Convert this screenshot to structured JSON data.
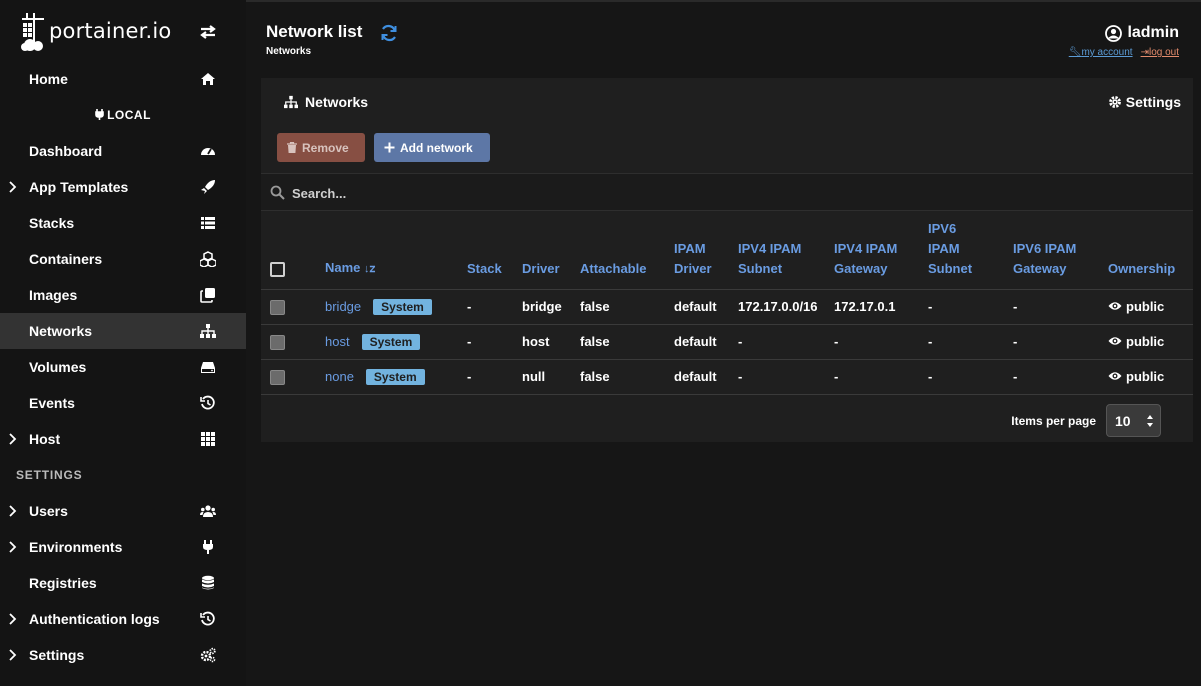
{
  "brand": {
    "logo_text": "portainer.io"
  },
  "sidebar": {
    "home": "Home",
    "environment": "LOCAL",
    "items": [
      {
        "label": "Dashboard",
        "icon": "tachometer-icon",
        "expandable": false
      },
      {
        "label": "App Templates",
        "icon": "rocket-icon",
        "expandable": true
      },
      {
        "label": "Stacks",
        "icon": "list-icon",
        "expandable": false
      },
      {
        "label": "Containers",
        "icon": "cubes-icon",
        "expandable": false
      },
      {
        "label": "Images",
        "icon": "clone-icon",
        "expandable": false
      },
      {
        "label": "Networks",
        "icon": "sitemap-icon",
        "expandable": false,
        "active": true
      },
      {
        "label": "Volumes",
        "icon": "hdd-icon",
        "expandable": false
      },
      {
        "label": "Events",
        "icon": "history-icon",
        "expandable": false
      },
      {
        "label": "Host",
        "icon": "th-icon",
        "expandable": true
      }
    ],
    "settings_heading": "SETTINGS",
    "settings_items": [
      {
        "label": "Users",
        "icon": "users-icon",
        "expandable": true
      },
      {
        "label": "Environments",
        "icon": "plug-icon",
        "expandable": true
      },
      {
        "label": "Registries",
        "icon": "database-icon",
        "expandable": false
      },
      {
        "label": "Authentication logs",
        "icon": "history-icon",
        "expandable": true
      },
      {
        "label": "Settings",
        "icon": "cogs-icon",
        "expandable": true
      }
    ]
  },
  "header": {
    "title": "Network list",
    "breadcrumb": "Networks",
    "username": "ladmin",
    "my_account": "my account",
    "log_out": "log out"
  },
  "panel": {
    "title": "Networks",
    "settings": "Settings",
    "remove_label": "Remove",
    "add_label": "Add network",
    "search_placeholder": "Search...",
    "columns": {
      "name": "Name",
      "stack": "Stack",
      "driver": "Driver",
      "attachable": "Attachable",
      "ipam_driver_1": "IPAM",
      "ipam_driver_2": "Driver",
      "ipv4_subnet_1": "IPV4 IPAM",
      "ipv4_subnet_2": "Subnet",
      "ipv4_gateway_1": "IPV4 IPAM",
      "ipv4_gateway_2": "Gateway",
      "ipv6_subnet_1": "IPV6",
      "ipv6_subnet_2": "IPAM",
      "ipv6_subnet_3": "Subnet",
      "ipv6_gateway_1": "IPV6 IPAM",
      "ipv6_gateway_2": "Gateway",
      "ownership": "Ownership"
    },
    "rows": [
      {
        "name": "bridge",
        "badge": "System",
        "stack": "-",
        "driver": "bridge",
        "attachable": "false",
        "ipam_driver": "default",
        "ipv4_subnet": "172.17.0.0/16",
        "ipv4_gateway": "172.17.0.1",
        "ipv6_subnet": "-",
        "ipv6_gateway": "-",
        "ownership": "public"
      },
      {
        "name": "host",
        "badge": "System",
        "stack": "-",
        "driver": "host",
        "attachable": "false",
        "ipam_driver": "default",
        "ipv4_subnet": "-",
        "ipv4_gateway": "-",
        "ipv6_subnet": "-",
        "ipv6_gateway": "-",
        "ownership": "public"
      },
      {
        "name": "none",
        "badge": "System",
        "stack": "-",
        "driver": "null",
        "attachable": "false",
        "ipam_driver": "default",
        "ipv4_subnet": "-",
        "ipv4_gateway": "-",
        "ipv6_subnet": "-",
        "ipv6_gateway": "-",
        "ownership": "public"
      }
    ],
    "items_per_page_label": "Items per page",
    "items_per_page_value": "10"
  },
  "colors": {
    "accent_link": "#6a9ce2",
    "badge": "#72b3df",
    "remove_button": "#874f43",
    "add_button": "#5d77a6",
    "active_nav": "#333333"
  }
}
